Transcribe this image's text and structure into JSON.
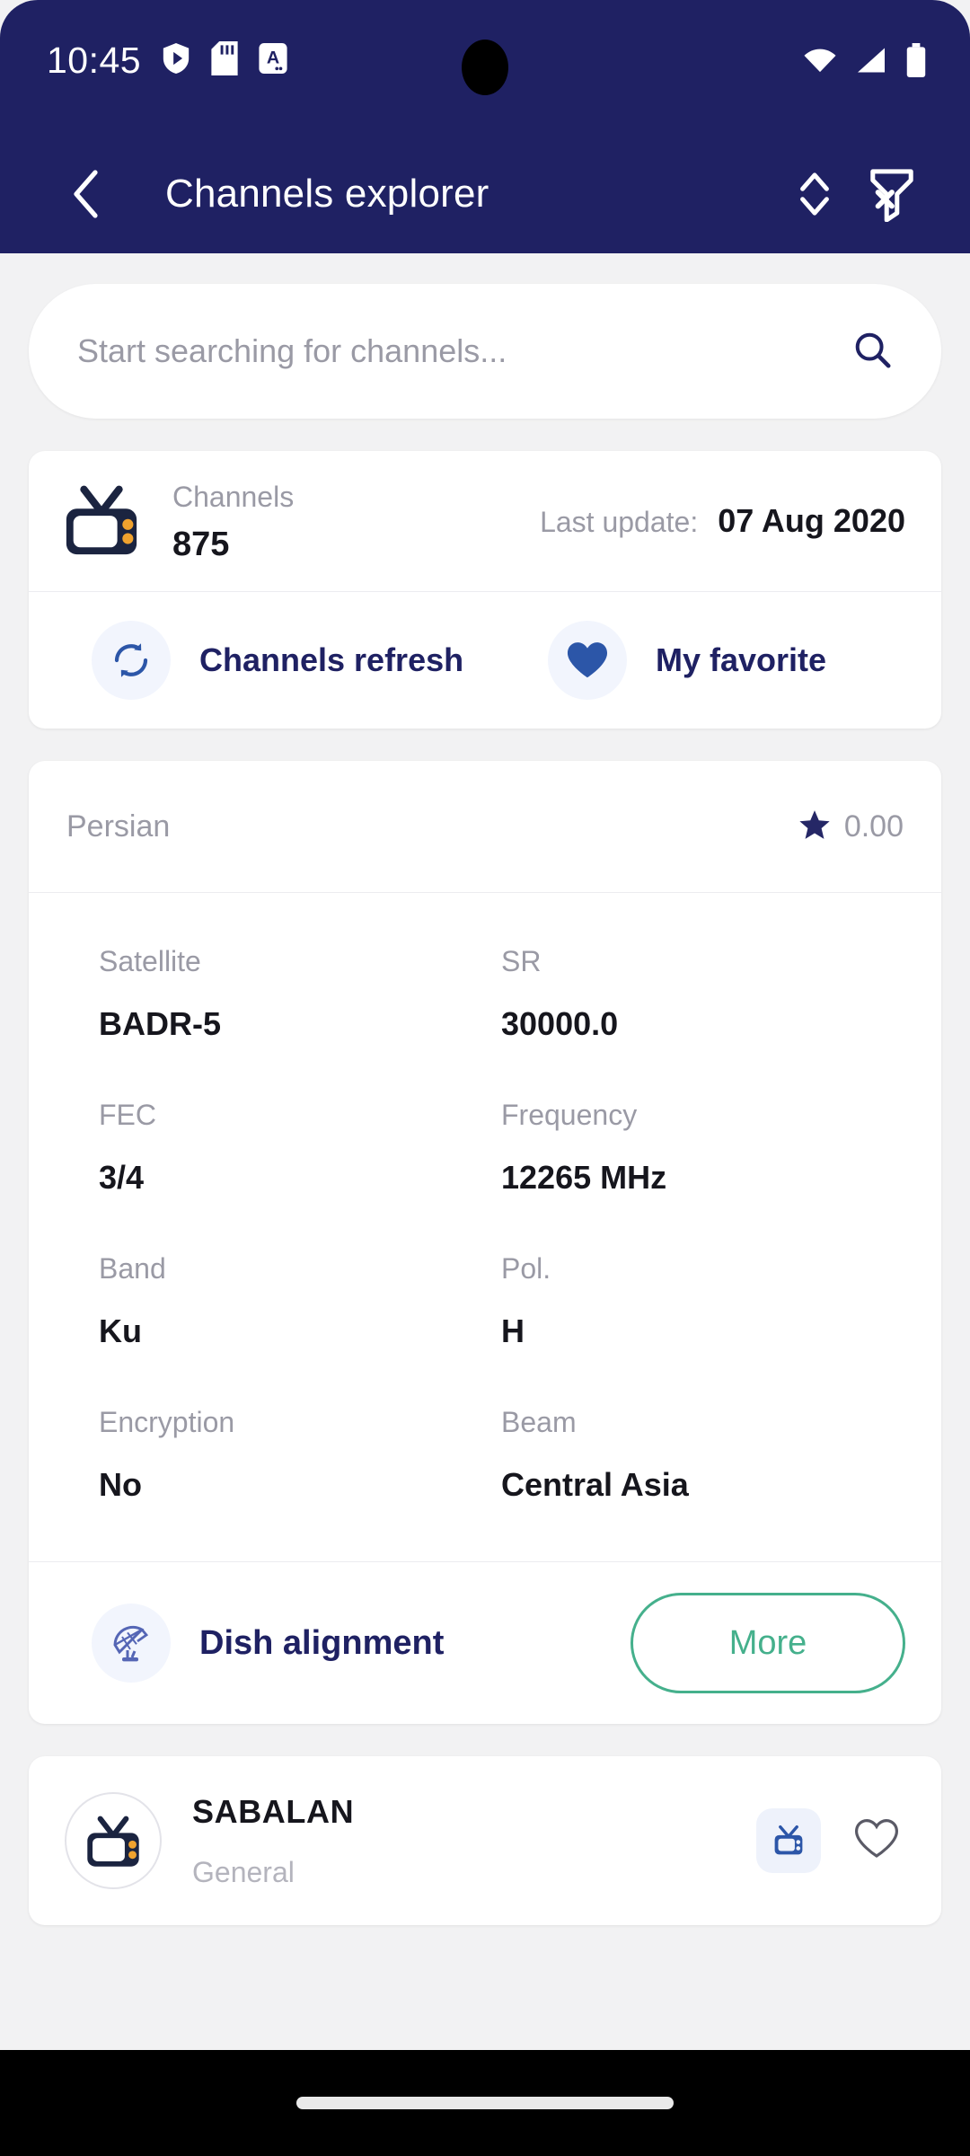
{
  "status_bar": {
    "time": "10:45",
    "left_icons": [
      "play-shield-icon",
      "sd-card-icon",
      "letter-a-icon"
    ],
    "right_icons": [
      "wifi-icon",
      "cellular-signal-icon",
      "battery-full-icon"
    ]
  },
  "app_bar": {
    "back_icon": "chevron-left-icon",
    "title": "Channels explorer",
    "sort_icon": "sort-updown-icon",
    "filter_icon": "filter-remove-icon"
  },
  "search": {
    "placeholder": "Start searching for channels...",
    "value": "",
    "icon": "search-icon"
  },
  "summary_card": {
    "tv_icon": "tv-icon",
    "channels_label": "Channels",
    "channels_count": "875",
    "last_update_label": "Last update:",
    "last_update_value": "07 Aug 2020",
    "actions": [
      {
        "icon": "refresh-icon",
        "label": "Channels refresh"
      },
      {
        "icon": "heart-filled-icon",
        "label": "My favorite"
      }
    ]
  },
  "transponder_card": {
    "language": "Persian",
    "rating_icon": "star-icon",
    "rating": "0.00",
    "details": [
      {
        "label": "Satellite",
        "value": "BADR-5"
      },
      {
        "label": "SR",
        "value": "30000.0"
      },
      {
        "label": "FEC",
        "value": "3/4"
      },
      {
        "label": "Frequency",
        "value": "12265 MHz"
      },
      {
        "label": "Band",
        "value": "Ku"
      },
      {
        "label": "Pol.",
        "value": "H"
      },
      {
        "label": "Encryption",
        "value": "No"
      },
      {
        "label": "Beam",
        "value": "Central Asia"
      }
    ],
    "dish_icon": "satellite-dish-icon",
    "dish_label": "Dish alignment",
    "more_label": "More"
  },
  "channel_list": [
    {
      "avatar_icon": "tv-icon",
      "name": "SABALAN",
      "genre": "General",
      "type_icon": "tv-small-icon",
      "favorite_icon": "heart-outline-icon"
    }
  ],
  "colors": {
    "brand_navy": "#1f2163",
    "accent_green": "#45b08c",
    "accent_blue": "#2c56a8",
    "page_bg": "#f2f2f3",
    "tv_orange": "#f0a22e"
  }
}
